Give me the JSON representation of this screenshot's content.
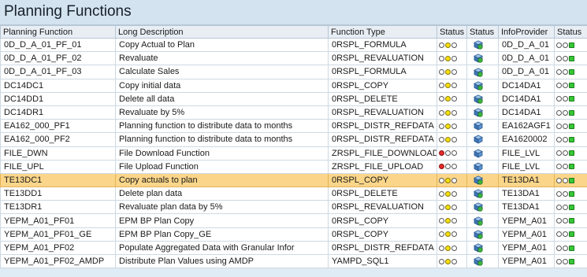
{
  "title": "Planning Functions",
  "columns": [
    "Planning Function",
    "Long Description",
    "Function Type",
    "Status",
    "Status",
    "InfoProvider",
    "Status"
  ],
  "rows": [
    {
      "pf": "0D_D_A_01_PF_01",
      "desc": "Copy Actual to Plan",
      "type": "0RSPL_FORMULA",
      "lamp": "yellow",
      "obj": "active",
      "prov": "0D_D_A_01",
      "light": "green"
    },
    {
      "pf": "0D_D_A_01_PF_02",
      "desc": "Revaluate",
      "type": "0RSPL_REVALUATION",
      "lamp": "yellow",
      "obj": "active",
      "prov": "0D_D_A_01",
      "light": "green"
    },
    {
      "pf": "0D_D_A_01_PF_03",
      "desc": "Calculate Sales",
      "type": "0RSPL_FORMULA",
      "lamp": "yellow",
      "obj": "active",
      "prov": "0D_D_A_01",
      "light": "green"
    },
    {
      "pf": "DC14DC1",
      "desc": "Copy initial data",
      "type": "0RSPL_COPY",
      "lamp": "yellow",
      "obj": "active",
      "prov": "DC14DA1",
      "light": "green"
    },
    {
      "pf": "DC14DD1",
      "desc": "Delete all data",
      "type": "0RSPL_DELETE",
      "lamp": "yellow",
      "obj": "active",
      "prov": "DC14DA1",
      "light": "green"
    },
    {
      "pf": "DC14DR1",
      "desc": "Revaluate by 5%",
      "type": "0RSPL_REVALUATION",
      "lamp": "yellow",
      "obj": "active",
      "prov": "DC14DA1",
      "light": "green"
    },
    {
      "pf": "EA162_000_PF1",
      "desc": "Planning function to distribute data to months",
      "type": "0RSPL_DISTR_REFDATA",
      "lamp": "yellow",
      "obj": "cube",
      "prov": "EA162AGF1",
      "light": "green"
    },
    {
      "pf": "EA162_000_PF2",
      "desc": "Planning function to distribute data to months",
      "type": "0RSPL_DISTR_REFDATA",
      "lamp": "yellow",
      "obj": "cube",
      "prov": "EA1620002",
      "light": "green"
    },
    {
      "pf": "FILE_DWN",
      "desc": "File Download Function",
      "type": "ZRSPL_FILE_DOWNLOAD",
      "lamp": "red",
      "obj": "cube",
      "prov": "FILE_LVL",
      "light": "green"
    },
    {
      "pf": "FILE_UPL",
      "desc": "File Upload Function",
      "type": "ZRSPL_FILE_UPLOAD",
      "lamp": "red",
      "obj": "cube",
      "prov": "FILE_LVL",
      "light": "green"
    },
    {
      "pf": "TE13DC1",
      "desc": "Copy actuals to plan",
      "type": "0RSPL_COPY",
      "lamp": "yellow",
      "obj": "active",
      "prov": "TE13DA1",
      "light": "green",
      "selected": true
    },
    {
      "pf": "TE13DD1",
      "desc": "Delete plan data",
      "type": "0RSPL_DELETE",
      "lamp": "yellow",
      "obj": "active",
      "prov": "TE13DA1",
      "light": "green"
    },
    {
      "pf": "TE13DR1",
      "desc": "Revaluate plan data by 5%",
      "type": "0RSPL_REVALUATION",
      "lamp": "yellow",
      "obj": "active",
      "prov": "TE13DA1",
      "light": "green"
    },
    {
      "pf": "YEPM_A01_PF01",
      "desc": "EPM BP Plan Copy",
      "type": "0RSPL_COPY",
      "lamp": "yellow",
      "obj": "active",
      "prov": "YEPM_A01",
      "light": "green"
    },
    {
      "pf": "YEPM_A01_PF01_GE",
      "desc": "EPM BP Plan Copy_GE",
      "type": "0RSPL_COPY",
      "lamp": "yellow",
      "obj": "active",
      "prov": "YEPM_A01",
      "light": "green"
    },
    {
      "pf": "YEPM_A01_PF02",
      "desc": "Populate Aggregated Data with Granular Infor",
      "type": "0RSPL_DISTR_REFDATA",
      "lamp": "yellow",
      "obj": "active",
      "prov": "YEPM_A01",
      "light": "green"
    },
    {
      "pf": "YEPM_A01_PF02_AMDP",
      "desc": "Distribute Plan Values using AMDP",
      "type": "YAMPD_SQL1",
      "lamp": "yellow",
      "obj": "active",
      "prov": "YEPM_A01",
      "light": "green"
    }
  ],
  "colors": {
    "header_bg": "#d3e3ef",
    "selected_row": "#fbd68a",
    "grid": "#cdd9e3"
  }
}
